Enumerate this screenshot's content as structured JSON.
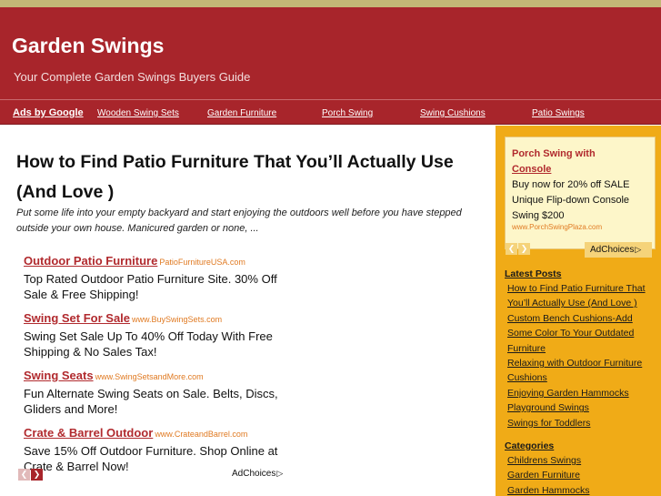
{
  "header": {
    "title": "Garden Swings",
    "tagline": "Your Complete Garden Swings Buyers Guide"
  },
  "nav": {
    "ads_label": "Ads by Google",
    "items": [
      "Wooden Swing Sets",
      "Garden Furniture",
      "Porch Swing",
      "Swing Cushions",
      "Patio Swings"
    ]
  },
  "post": {
    "title": "How to Find Patio Furniture That You’ll Actually Use (And Love )",
    "excerpt": "Put some life into your empty backyard and start enjoying the outdoors well before you have stepped outside your own house. Manicured garden or none, ..."
  },
  "ads": [
    {
      "title": "Outdoor Patio Furniture",
      "url": "PatioFurnitureUSA.com",
      "desc": "Top Rated Outdoor Patio Furniture Site. 30% Off Sale & Free Shipping!"
    },
    {
      "title": "Swing Set For Sale",
      "url": "www.BuySwingSets.com",
      "desc": "Swing Set Sale Up To 40% Off Today With Free Shipping & No Sales Tax!"
    },
    {
      "title": "Swing Seats",
      "url": "www.SwingSetsandMore.com",
      "desc": "Fun Alternate Swing Seats on Sale. Belts, Discs, Gliders and More!"
    },
    {
      "title": "Crate & Barrel Outdoor",
      "url": "www.CrateandBarrel.com",
      "desc": "Save 15% Off Outdoor Furniture. Shop Online at Crate & Barrel Now!"
    }
  ],
  "adchoices": "AdChoices",
  "sidebar_ad": {
    "title_line1": "Porch Swing with",
    "title_line2": "Console",
    "desc": "Buy now for 20% off SALE Unique Flip-down Console Swing $200",
    "url": "www.PorchSwingPlaza.com"
  },
  "latest_posts": {
    "heading": "Latest Posts",
    "items": [
      "How to Find Patio Furniture That",
      "You’ll Actually Use (And Love )",
      "Custom Bench Cushions-Add",
      "Some Color To Your Outdated",
      "Furniture",
      "Relaxing with Outdoor Furniture",
      "Cushions",
      "Enjoying Garden Hammocks",
      "Playground Swings",
      "Swings for Toddlers"
    ]
  },
  "categories": {
    "heading": "Categories",
    "items": [
      "Childrens Swings",
      "Garden Furniture",
      "Garden Hammocks"
    ]
  },
  "colors": {
    "header_red": "#a8252b",
    "sidebar_orange": "#f0ab17",
    "ad_link_red": "#b12a2e",
    "ad_url_orange": "#e07a22"
  }
}
